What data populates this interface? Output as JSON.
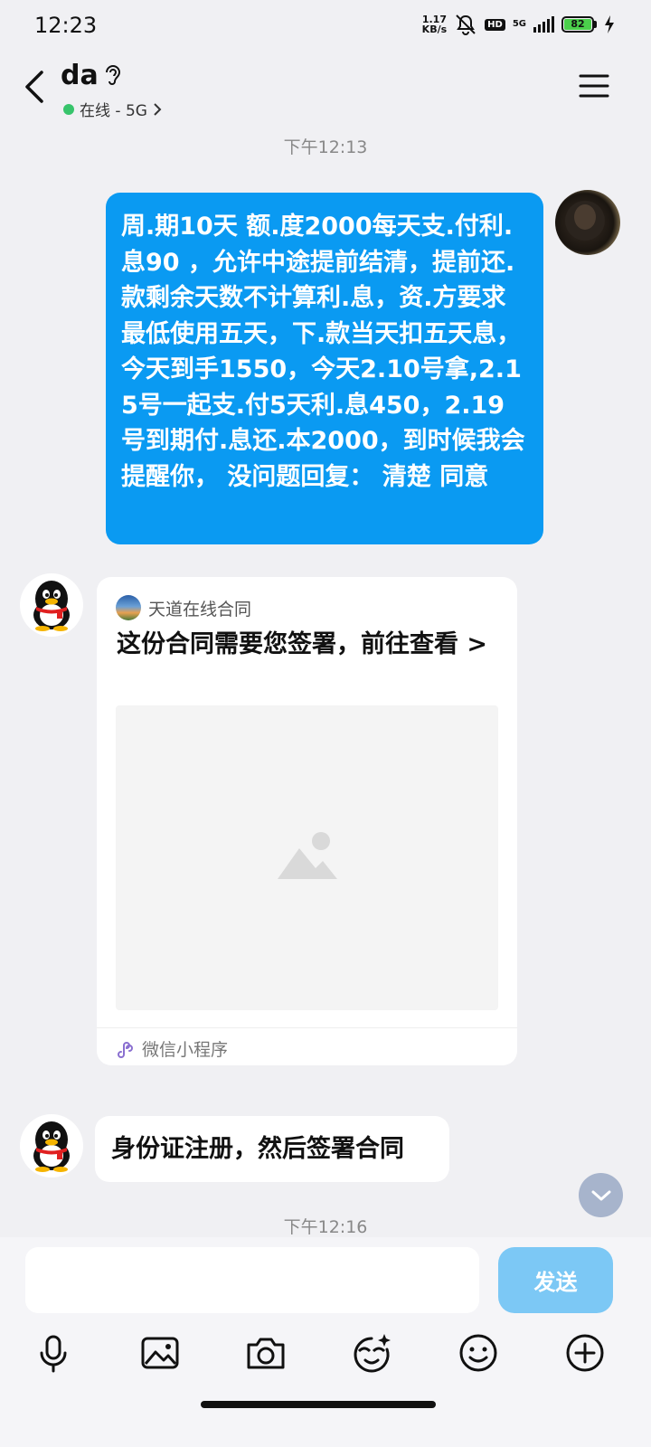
{
  "status_bar": {
    "time": "12:23",
    "speed_value": "1.17",
    "speed_unit": "KB/s",
    "hd": "HD",
    "network": "5G",
    "battery": "82"
  },
  "header": {
    "contact_name": "da",
    "status": "在线 - 5G"
  },
  "messages": {
    "time_1": "下午12:13",
    "outgoing_text": "周.期10天 额.度2000每天支.付利.息90 ，允许中途提前结清，提前还.款剩余天数不计算利.息，资.方要求最低使用五天，下.款当天扣五天息，今天到手1550，今天2.10号拿,2.15号一起支.付5天利.息450，2.19号到期付.息还.本2000，到时候我会提醒你， 没问题回复： 清楚 同意",
    "card_source": "天道在线合同",
    "card_title": "这份合同需要您签署，前往查看 >",
    "card_footer": "微信小程序",
    "incoming_text": "身份证注册，然后签署合同",
    "time_2": "下午12:16"
  },
  "input": {
    "send_label": "发送"
  },
  "colors": {
    "outgoing_bubble": "#0a9af2",
    "send_button": "#7cc8f5",
    "online_dot": "#37c46b"
  }
}
